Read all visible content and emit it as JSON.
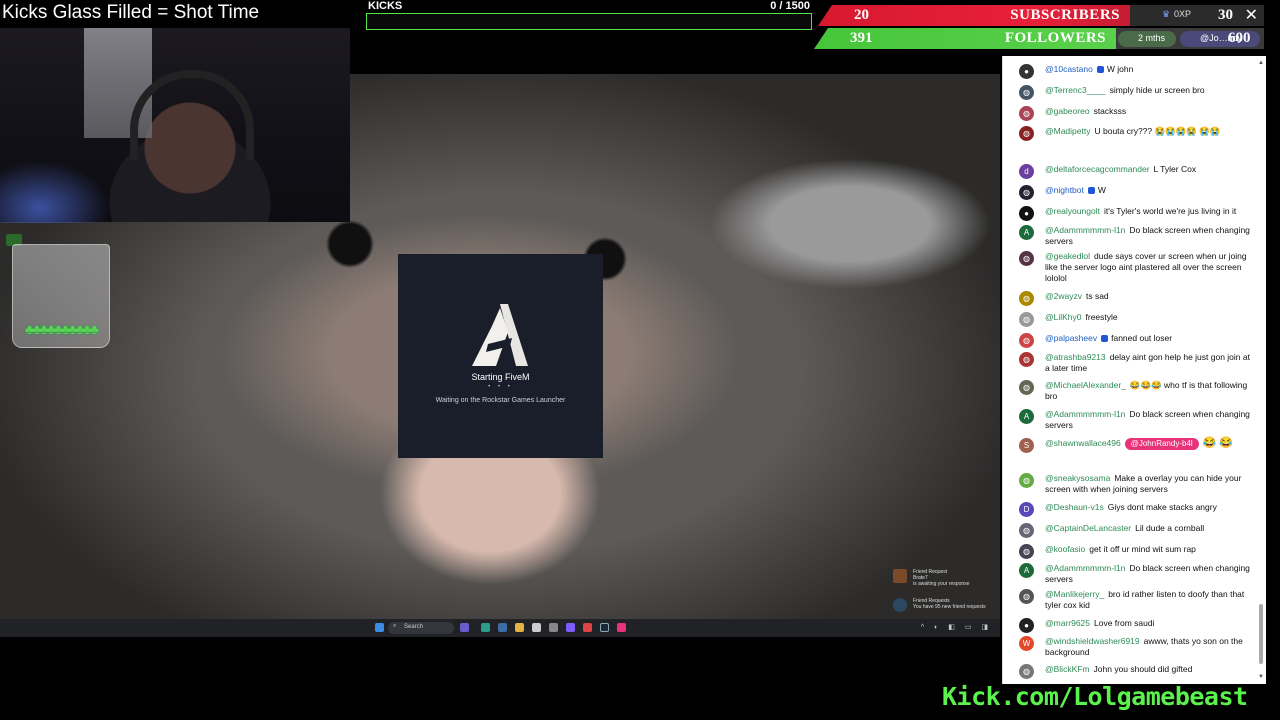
{
  "overlay": {
    "title": "Kicks Glass Filled =  Shot Time",
    "kicks_label": "KICKS",
    "kicks_count": "0  / 1500",
    "kicks_progress": 0,
    "subscribers_count": "20",
    "subscribers_label": "SUBSCRIBERS",
    "followers_count": "391",
    "followers_label": "FOLLOWERS",
    "xp_label": "0XP",
    "xp_value": "30",
    "goal_pill_a": "2 mths",
    "goal_pill_b": "@Jo…ndy",
    "goal_value": "600",
    "jar_clovers": "♣♣♣♣♣♣♣♣♣♣",
    "kick_url": "Kick.com/Lolgamebeast",
    "colors": {
      "green": "#55e34a",
      "red": "#e8203a",
      "kick_green": "#5cf24d"
    }
  },
  "game": {
    "loader_title": "Starting FiveM",
    "loader_dots": "• • •",
    "loader_subtitle": "Waiting on the Rockstar Games Launcher",
    "notifications": [
      {
        "line1": "Friend Request",
        "line2": "Brate7",
        "line3": "is awaiting your response"
      },
      {
        "line1": "Friend Requests",
        "line2": "You have 95 new friend requests",
        "line3": ""
      }
    ],
    "taskbar_search": "Search",
    "taskbar_tray": "^ ◐ ◧ ▭ ◨"
  },
  "chat": {
    "messages": [
      {
        "user": "@10castano",
        "text": "W john",
        "avatar": "●",
        "avatar_color": "#333",
        "blue": true,
        "badge": true
      },
      {
        "user": "@Terrenc3____",
        "text": "simply hide ur screen bro",
        "avatar": "◍",
        "avatar_color": "#456",
        "blue": false,
        "badge": false
      },
      {
        "user": "@gabeoreo",
        "text": "stacksss",
        "avatar": "◍",
        "avatar_color": "#a45",
        "blue": false,
        "badge": false
      },
      {
        "user": "@Madipetty",
        "text": "U bouta cry??? 😭😭😭😭 😭😭",
        "avatar": "◍",
        "avatar_color": "#822",
        "blue": false,
        "badge": false
      },
      {
        "user": "@deltaforcecagcommander",
        "text": "L Tyler Cox",
        "avatar": "d",
        "avatar_color": "#6b3fa0",
        "blue": false,
        "badge": false
      },
      {
        "user": "@nightbot",
        "text": "W",
        "avatar": "◍",
        "avatar_color": "#223",
        "blue": true,
        "badge": true
      },
      {
        "user": "@realyoungolt",
        "text": "it's Tyler's world we're jus living in it",
        "avatar": "●",
        "avatar_color": "#111",
        "blue": false,
        "badge": false
      },
      {
        "user": "@Adammmmmm-l1n",
        "text": "Do black screen when changing servers",
        "avatar": "A",
        "avatar_color": "#1d6b3a",
        "blue": false,
        "badge": false
      },
      {
        "user": "@geakedlol",
        "text": "dude says cover ur screen when ur joing like the server logo aint plastered all over the screen lololol",
        "avatar": "◍",
        "avatar_color": "#534",
        "blue": false,
        "badge": false
      },
      {
        "user": "@2wayzv",
        "text": "ts sad",
        "avatar": "◍",
        "avatar_color": "#a80",
        "blue": false,
        "badge": false
      },
      {
        "user": "@LilKhy0",
        "text": "freestyle",
        "avatar": "◍",
        "avatar_color": "#999",
        "blue": false,
        "badge": false
      },
      {
        "user": "@palpasheev",
        "text": "fanned out loser",
        "avatar": "◍",
        "avatar_color": "#c44",
        "blue": true,
        "badge": true
      },
      {
        "user": "@atrashba9213",
        "text": "delay aint gon help he just gon join at a later time",
        "avatar": "◍",
        "avatar_color": "#a33",
        "blue": false,
        "badge": false
      },
      {
        "user": "@MichaelAlexander_",
        "text": "😂😂😂 who tf is that following bro",
        "avatar": "◍",
        "avatar_color": "#665",
        "blue": false,
        "badge": false
      },
      {
        "user": "@Adammmmmm-l1n",
        "text": "Do black screen when changing servers",
        "avatar": "A",
        "avatar_color": "#1d6b3a",
        "blue": false,
        "badge": false
      },
      {
        "user": "@shawnwallace496",
        "text": "",
        "mention": "@JohnRandy-b4l",
        "after": "😂 😂",
        "avatar": "S",
        "avatar_color": "#a06050",
        "blue": false,
        "badge": false
      },
      {
        "user": "@sneakysosama",
        "text": "Make a overlay you can hide your screen with when joining servers",
        "avatar": "◍",
        "avatar_color": "#6a4",
        "blue": false,
        "badge": false
      },
      {
        "user": "@Deshaun-v1s",
        "text": "Giys dont make stacks angry",
        "avatar": "D",
        "avatar_color": "#5b47b8",
        "blue": false,
        "badge": false
      },
      {
        "user": "@CaptainDeLancaster",
        "text": "Lil dude a cornball",
        "avatar": "◍",
        "avatar_color": "#667",
        "blue": false,
        "badge": false
      },
      {
        "user": "@koofasio",
        "text": "get it off ur mind wit sum rap",
        "avatar": "◍",
        "avatar_color": "#445",
        "blue": false,
        "badge": false
      },
      {
        "user": "@Adammmmmm-l1n",
        "text": "Do black screen when changing servers",
        "avatar": "A",
        "avatar_color": "#1d6b3a",
        "blue": false,
        "badge": false
      },
      {
        "user": "@Manlikejerry_",
        "text": "bro id rather listen to doofy than that tyler cox kid",
        "avatar": "◍",
        "avatar_color": "#555",
        "blue": false,
        "badge": false
      },
      {
        "user": "@marr9625",
        "text": "Love from saudi",
        "avatar": "●",
        "avatar_color": "#222",
        "blue": false,
        "badge": false
      },
      {
        "user": "@windshieldwasher6919",
        "text": "awww, thats yo son on the background",
        "avatar": "W",
        "avatar_color": "#e04a2a",
        "blue": false,
        "badge": false
      },
      {
        "user": "@BlickKFm",
        "text": "John you should did gifted",
        "avatar": "◍",
        "avatar_color": "#777",
        "blue": false,
        "badge": false
      }
    ]
  }
}
